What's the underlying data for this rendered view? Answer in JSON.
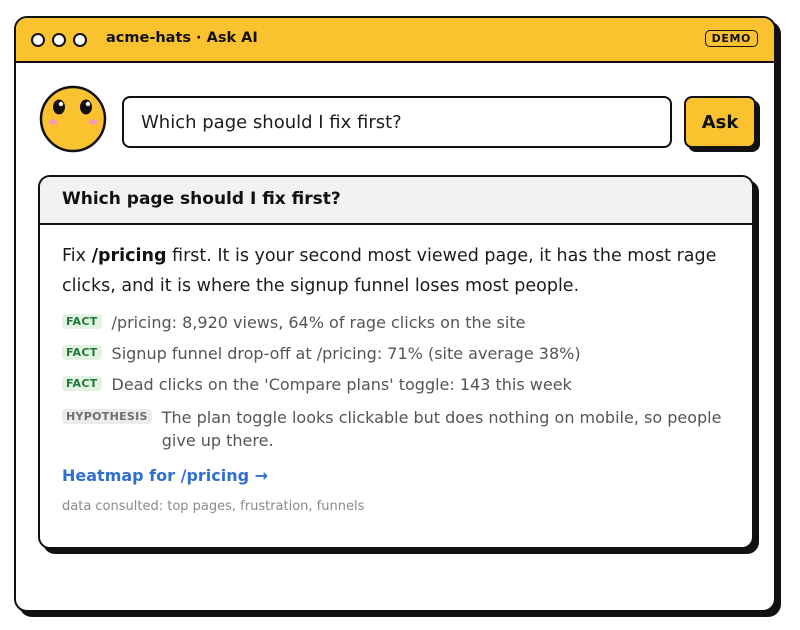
{
  "window": {
    "title": "acme-hats · Ask AI",
    "badge": "DEMO",
    "accent_color": "#fbc230"
  },
  "mascot": {
    "icon": "smiley-face-icon"
  },
  "search": {
    "value": "Which page should I fix first?",
    "button_label": "Ask"
  },
  "answer": {
    "question": "Which page should I fix first?",
    "summary_prefix": "Fix ",
    "summary_highlight": "/pricing",
    "summary_suffix": " first. It is your second most viewed page, it has the most rage clicks, and it is where the signup funnel loses most people.",
    "facts": [
      {
        "tag": "FACT",
        "text": "/pricing: 8,920 views, 64% of rage clicks on the site"
      },
      {
        "tag": "FACT",
        "text": "Signup funnel drop-off at /pricing: 71% (site average 38%)"
      },
      {
        "tag": "FACT",
        "text": "Dead clicks on the 'Compare plans' toggle: 143 this week"
      }
    ],
    "hypothesis": {
      "tag": "HYPOTHESIS",
      "text": "The plan toggle looks clickable but does nothing on mobile, so people give up there."
    },
    "link_label": "Heatmap for /pricing →",
    "consulted": "data consulted: top pages, frustration, funnels"
  }
}
